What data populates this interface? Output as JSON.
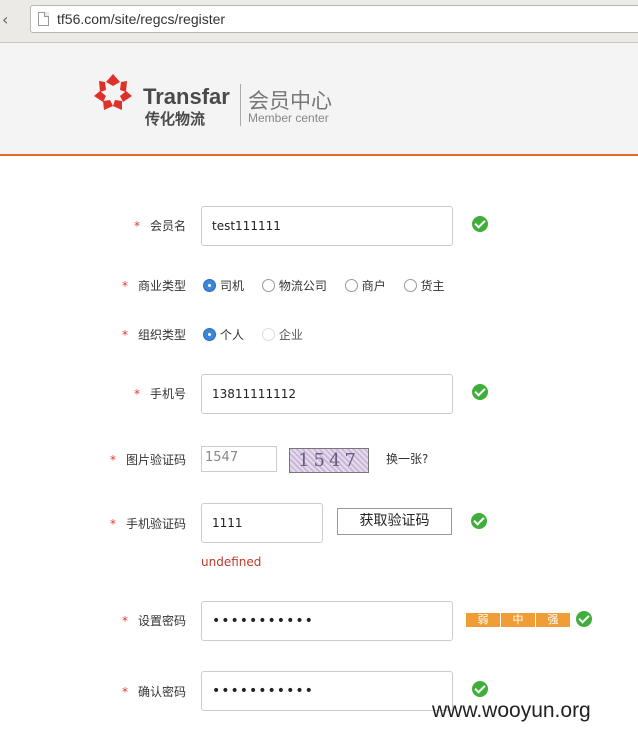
{
  "browser": {
    "url": "tf56.com/site/regcs/register"
  },
  "header": {
    "brand_en": "Transfar",
    "brand_cn": "传化物流",
    "center_cn": "会员中心",
    "center_en": "Member center",
    "accent_color": "#e26a26"
  },
  "form": {
    "required_mark": "*",
    "member_name": {
      "label": "会员名",
      "value": "test111111"
    },
    "business_type": {
      "label": "商业类型",
      "options": [
        "司机",
        "物流公司",
        "商户",
        "货主"
      ],
      "selected": "司机"
    },
    "org_type": {
      "label": "组织类型",
      "options": [
        "个人",
        "企业"
      ],
      "selected": "个人"
    },
    "phone": {
      "label": "手机号",
      "value": "13811111112"
    },
    "image_captcha": {
      "label": "图片验证码",
      "value": "1547",
      "image_text": "1547",
      "refresh_link": "换一张?"
    },
    "sms_code": {
      "label": "手机验证码",
      "value": "1111",
      "button": "获取验证码",
      "error": "undefined"
    },
    "password": {
      "label": "设置密码",
      "value": "•••••••••••",
      "strength": [
        "弱",
        "中",
        "强"
      ]
    },
    "confirm_password": {
      "label": "确认密码",
      "value": "•••••••••••"
    }
  },
  "watermark": "www.wooyun.org"
}
